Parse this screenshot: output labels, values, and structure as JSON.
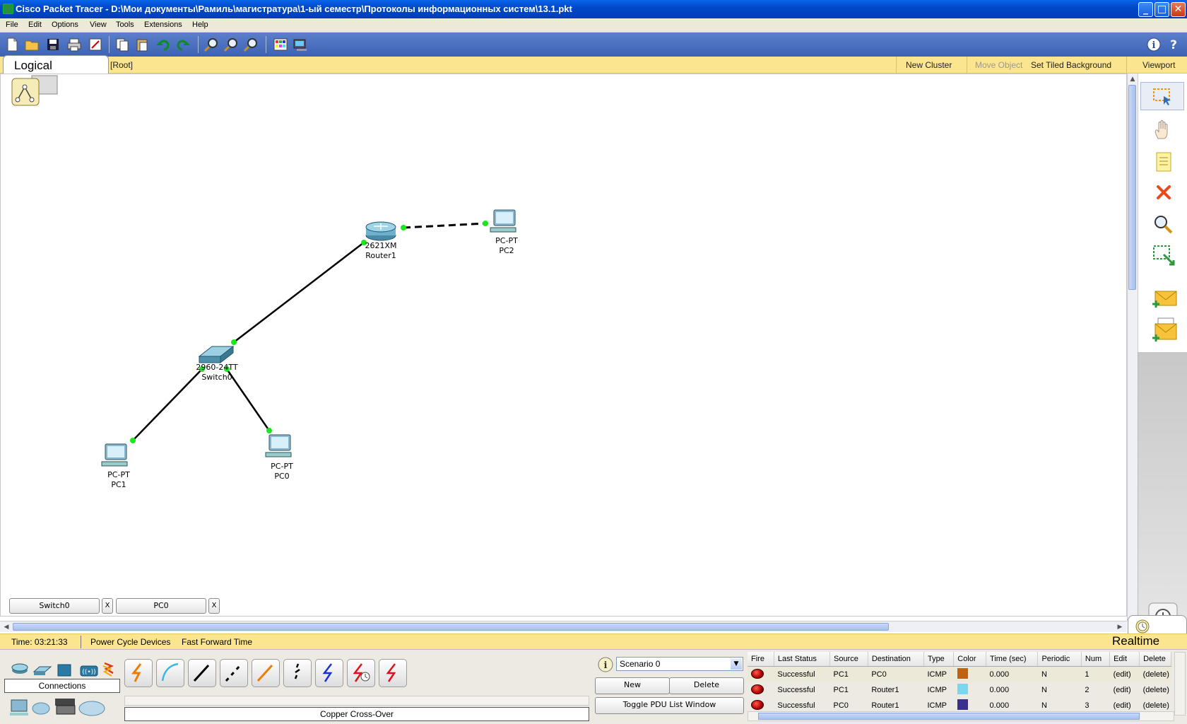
{
  "window": {
    "title": "Cisco Packet Tracer - D:\\Мои документы\\Рамиль\\магистратура\\1-ый семестр\\Протоколы информационных систем\\13.1.pkt",
    "min_label": "_",
    "max_label": "□",
    "close_label": "✕"
  },
  "menu": [
    "File",
    "Edit",
    "Options",
    "View",
    "Tools",
    "Extensions",
    "Help"
  ],
  "toolbar_icons": [
    "new-file-icon",
    "open-folder-icon",
    "save-icon",
    "print-icon",
    "activity-wizard-icon",
    "copy-icon",
    "paste-icon",
    "undo-icon",
    "redo-icon",
    "zoom-in-icon",
    "zoom-reset-icon",
    "zoom-out-icon",
    "palette-icon",
    "custom-device-icon"
  ],
  "workspace": {
    "tab_label": "Logical",
    "root_label": "[Root]",
    "new_cluster": "New Cluster",
    "move_object": "Move Object",
    "set_tiled_background": "Set Tiled Background",
    "viewport": "Viewport"
  },
  "devices": {
    "router1": {
      "model": "2621XM",
      "name": "Router1"
    },
    "pc2": {
      "model": "PC-PT",
      "name": "PC2"
    },
    "switch0": {
      "model": "2960-24TT",
      "name": "Switch0"
    },
    "pc1": {
      "model": "PC-PT",
      "name": "PC1"
    },
    "pc0": {
      "model": "PC-PT",
      "name": "PC0"
    }
  },
  "open_windows": [
    {
      "label": "Switch0",
      "close": "X"
    },
    {
      "label": "PC0",
      "close": "X"
    }
  ],
  "right_tools": [
    "select-icon",
    "move-hand-icon",
    "note-icon",
    "delete-icon",
    "inspect-icon",
    "resize-shape-icon",
    "add-simple-pdu-icon",
    "add-complex-pdu-icon"
  ],
  "status": {
    "time": "Time: 03:21:33",
    "power_cycle": "Power Cycle Devices",
    "fast_forward": "Fast Forward Time",
    "mode": "Realtime"
  },
  "devices_panel": {
    "category_label": "Connections",
    "selected_connection": "Copper Cross-Over",
    "connection_types": [
      {
        "icon": "automatic-connection-icon",
        "color": "#f07b00"
      },
      {
        "icon": "console-cable-icon",
        "color": "#38b6e6"
      },
      {
        "icon": "copper-straight-through-icon",
        "color": "#000000"
      },
      {
        "icon": "copper-cross-over-icon",
        "color": "#000000"
      },
      {
        "icon": "fiber-icon",
        "color": "#f07b00"
      },
      {
        "icon": "phone-cable-icon",
        "color": "#000000"
      },
      {
        "icon": "coaxial-icon",
        "color": "#1a32d6"
      },
      {
        "icon": "serial-dce-icon",
        "color": "#e0101c"
      },
      {
        "icon": "serial-dte-icon",
        "color": "#e0101c"
      }
    ]
  },
  "scenario": {
    "selected": "Scenario 0",
    "new_label": "New",
    "delete_label": "Delete",
    "toggle_label": "Toggle PDU List Window"
  },
  "pdu_table": {
    "headers": [
      "Fire",
      "Last Status",
      "Source",
      "Destination",
      "Type",
      "Color",
      "Time (sec)",
      "Periodic",
      "Num",
      "Edit",
      "Delete"
    ],
    "rows": [
      {
        "status": "Successful",
        "source": "PC1",
        "destination": "PC0",
        "type": "ICMP",
        "color": "#c06010",
        "time": "0.000",
        "periodic": "N",
        "num": "1",
        "edit": "(edit)",
        "delete": "(delete)"
      },
      {
        "status": "Successful",
        "source": "PC1",
        "destination": "Router1",
        "type": "ICMP",
        "color": "#78d8f0",
        "time": "0.000",
        "periodic": "N",
        "num": "2",
        "edit": "(edit)",
        "delete": "(delete)"
      },
      {
        "status": "Successful",
        "source": "PC0",
        "destination": "Router1",
        "type": "ICMP",
        "color": "#3a2f8f",
        "time": "0.000",
        "periodic": "N",
        "num": "3",
        "edit": "(edit)",
        "delete": "(delete)"
      }
    ]
  }
}
